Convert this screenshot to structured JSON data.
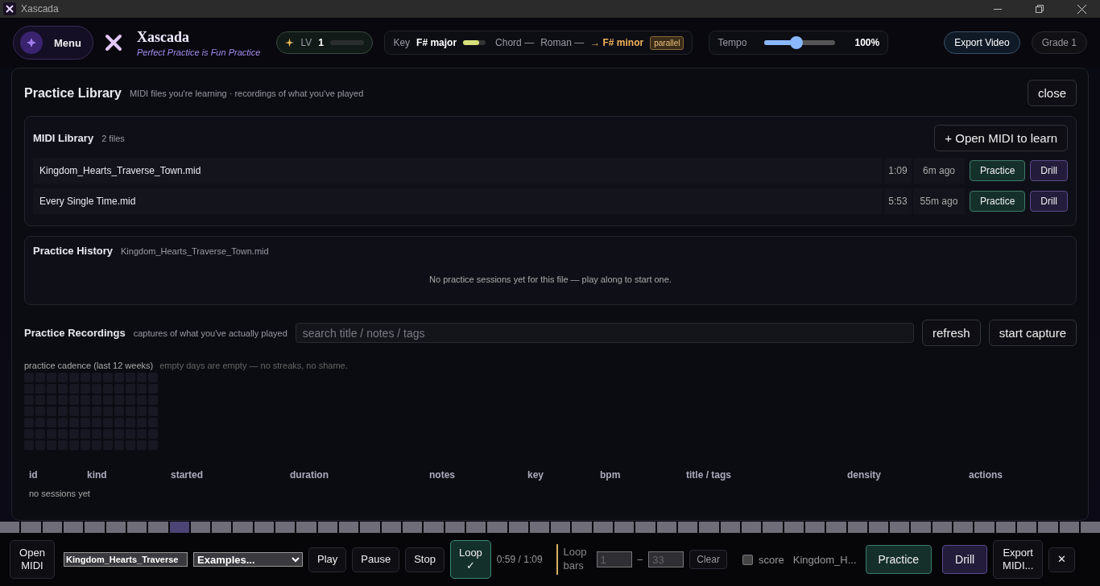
{
  "window": {
    "title": "Xascada"
  },
  "header": {
    "menu_label": "Menu",
    "app_name": "Xascada",
    "tagline": "Perfect Practice is Fun Practice",
    "level": {
      "label": "LV",
      "value": "1"
    },
    "key": {
      "label": "Key",
      "value": "F# major",
      "level": 0.72,
      "chord": "Chord —",
      "roman": "Roman —",
      "target": "→ F# minor",
      "badge": "parallel"
    },
    "tempo": {
      "label": "Tempo",
      "level": 0.45,
      "reading": "100%"
    },
    "buttons": [
      "Export Video",
      "Grade 1"
    ]
  },
  "modal": {
    "title": "Practice Library",
    "subtitle": "MIDI files you're learning · recordings of what you've played",
    "close": "close",
    "midi_library": {
      "title": "MIDI Library",
      "count": "2 files",
      "open_button": "+ Open MIDI to learn",
      "files": [
        {
          "name": "Kingdom_Hearts_Traverse_Town.mid",
          "duration": "1:09",
          "ago": "6m ago",
          "practice": "Practice",
          "drill": "Drill"
        },
        {
          "name": "Every Single Time.mid",
          "duration": "5:53",
          "ago": "55m ago",
          "practice": "Practice",
          "drill": "Drill"
        }
      ]
    },
    "history": {
      "title": "Practice History",
      "file": "Kingdom_Hearts_Traverse_Town.mid",
      "empty": "No practice sessions yet for this file — play along to start one."
    },
    "recordings": {
      "title": "Practice Recordings",
      "subtitle": "captures of what you've actually played",
      "search_placeholder": "search title / notes / tags",
      "buttons": [
        "refresh",
        "start capture"
      ],
      "cadence_label": "practice cadence (last 12 weeks)",
      "cadence_note": "empty days are empty — no streaks, no shame.",
      "columns": [
        "id",
        "kind",
        "started",
        "duration",
        "notes",
        "key",
        "bpm",
        "title / tags",
        "density",
        "actions"
      ],
      "empty": "no sessions yet"
    }
  },
  "keyboard": {
    "keys": [
      {
        "pressed": false
      },
      {
        "pressed": false
      },
      {
        "pressed": false
      },
      {
        "pressed": false
      },
      {
        "pressed": false
      },
      {
        "pressed": false
      },
      {
        "pressed": false
      },
      {
        "pressed": false
      },
      {
        "pressed": true
      },
      {
        "pressed": false
      },
      {
        "pressed": false
      },
      {
        "pressed": false
      },
      {
        "pressed": false
      },
      {
        "pressed": false
      },
      {
        "pressed": false
      },
      {
        "pressed": false
      },
      {
        "pressed": false
      },
      {
        "pressed": false
      },
      {
        "pressed": false
      },
      {
        "pressed": false
      },
      {
        "pressed": false
      },
      {
        "pressed": false
      },
      {
        "pressed": false
      },
      {
        "pressed": false
      },
      {
        "pressed": false
      },
      {
        "pressed": false
      },
      {
        "pressed": false
      },
      {
        "pressed": false
      },
      {
        "pressed": false
      },
      {
        "pressed": false
      },
      {
        "pressed": false
      },
      {
        "pressed": false
      },
      {
        "pressed": false
      },
      {
        "pressed": false
      },
      {
        "pressed": false
      },
      {
        "pressed": false
      },
      {
        "pressed": false
      },
      {
        "pressed": false
      },
      {
        "pressed": false
      },
      {
        "pressed": false
      },
      {
        "pressed": false
      },
      {
        "pressed": false
      },
      {
        "pressed": false
      },
      {
        "pressed": false
      },
      {
        "pressed": false
      },
      {
        "pressed": false
      },
      {
        "pressed": false
      },
      {
        "pressed": false
      },
      {
        "pressed": false
      },
      {
        "pressed": false
      },
      {
        "pressed": false
      },
      {
        "pressed": false
      }
    ]
  },
  "toolbar": {
    "open_midi": "Open MIDI",
    "file_value": "Kingdom_Hearts_Traverse",
    "examples": "Examples...",
    "play": "Play",
    "pause": "Pause",
    "stop": "Stop",
    "loop": {
      "label": "Loop",
      "mark": "✓",
      "selected": true
    },
    "time": "0:59 / 1:09",
    "loop_bars": "Loop bars",
    "loop_from_placeholder": "1",
    "dash": "–",
    "loop_to_placeholder": "33",
    "clear": "Clear",
    "score": {
      "label": "score",
      "checked": false
    },
    "file_short": "Kingdom_H...",
    "practice": "Practice",
    "drill": "Drill",
    "export": "Export MIDI...",
    "close": "✕"
  }
}
